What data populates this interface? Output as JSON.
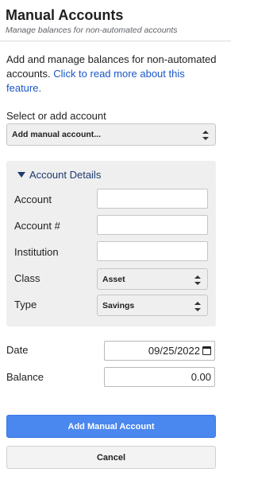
{
  "header": {
    "title": "Manual Accounts",
    "subtitle": "Manage balances for non-automated accounts"
  },
  "intro": {
    "text": "Add and manage balances for non-automated accounts.",
    "link": "Click to read more about this feature."
  },
  "account_select": {
    "label": "Select or add account",
    "value": "Add manual account..."
  },
  "details": {
    "summary": "Account Details",
    "account_label": "Account",
    "account_value": "",
    "account_number_label": "Account #",
    "account_number_value": "",
    "institution_label": "Institution",
    "institution_value": "",
    "class_label": "Class",
    "class_value": "Asset",
    "type_label": "Type",
    "type_value": "Savings"
  },
  "date": {
    "label": "Date",
    "value": "09/25/2022"
  },
  "balance": {
    "label": "Balance",
    "value": "0.00"
  },
  "actions": {
    "add_label": "Add Manual Account",
    "cancel_label": "Cancel"
  },
  "colors": {
    "primary": "#4a87ee",
    "link": "#1a56c8",
    "details_bg": "#efefef"
  }
}
